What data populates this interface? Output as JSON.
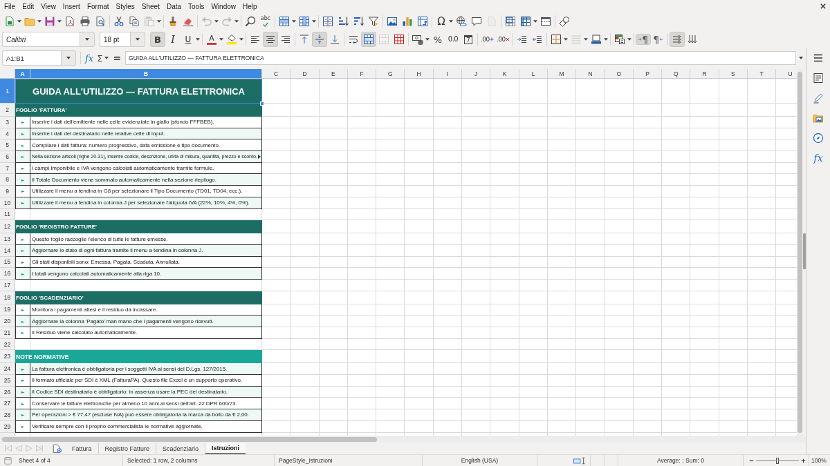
{
  "menu": [
    "File",
    "Edit",
    "View",
    "Insert",
    "Format",
    "Styles",
    "Sheet",
    "Data",
    "Tools",
    "Window",
    "Help"
  ],
  "standard_toolbar": {
    "paste": {
      "disabled": true
    },
    "undo": {
      "disabled": true
    },
    "redo": {
      "disabled": true
    },
    "spelling": {
      "glyph": "abc"
    },
    "special_character": {
      "glyph": "Ω"
    },
    "headers_and_footers": {
      "disabled": true
    }
  },
  "formatting_toolbar": {
    "font_name": "Calibri",
    "font_size": "18 pt",
    "bold": {
      "glyph": "B",
      "selected": true
    },
    "italic": {
      "glyph": "I",
      "selected": false
    },
    "underline": {
      "glyph": "U",
      "selected": false
    },
    "font_color": {
      "glyph": "A"
    },
    "align_left": {
      "selected": false
    },
    "align_center": {
      "selected": true
    },
    "align_right": {
      "selected": false
    },
    "align_top": {
      "selected": false
    },
    "center_vertically": {
      "selected": true
    },
    "align_bottom": {
      "selected": false
    },
    "wrap_text": {
      "selected": false
    },
    "merge_and_center": {
      "selected": true
    },
    "merge_cells": {
      "disabled": true
    },
    "percent": {
      "glyph": "%"
    },
    "number_format": {
      "glyph": "0.0"
    },
    "date_format": {
      "glyph": "7"
    },
    "add_decimal": {
      "glyph": ".00"
    },
    "delete_decimal": {
      "glyph": ".00"
    },
    "border_style": {
      "disabled": true
    },
    "left_to_right": {
      "glyph": "¶",
      "selected": true
    },
    "right_to_left": {
      "glyph": "¶",
      "selected": false
    },
    "text_left_to_right": {
      "selected": true
    },
    "text_top_to_bottom": {
      "selected": false
    }
  },
  "formula_bar": {
    "name_box": "A1:B1",
    "function_wizard": "fx",
    "sum": "Σ",
    "formula": "=",
    "content": "GUIDA ALL'UTILIZZO — FATTURA ELETTRONICA"
  },
  "columns": [
    {
      "label": "A",
      "selected": true
    },
    {
      "label": "B",
      "selected": true
    },
    {
      "label": "C",
      "selected": false
    },
    {
      "label": "D",
      "selected": false
    },
    {
      "label": "E",
      "selected": false
    },
    {
      "label": "F",
      "selected": false
    },
    {
      "label": "G",
      "selected": false
    },
    {
      "label": "H",
      "selected": false
    },
    {
      "label": "I",
      "selected": false
    },
    {
      "label": "J",
      "selected": false
    },
    {
      "label": "K",
      "selected": false
    },
    {
      "label": "L",
      "selected": false
    },
    {
      "label": "M",
      "selected": false
    },
    {
      "label": "N",
      "selected": false
    },
    {
      "label": "O",
      "selected": false
    },
    {
      "label": "P",
      "selected": false
    },
    {
      "label": "Q",
      "selected": false
    },
    {
      "label": "R",
      "selected": false
    },
    {
      "label": "S",
      "selected": false
    },
    {
      "label": "T",
      "selected": false
    },
    {
      "label": "U",
      "selected": false
    }
  ],
  "rows": [
    {
      "number": "1",
      "selected": true,
      "kind": "title",
      "text": "GUIDA ALL'UTILIZZO — FATTURA ELETTRONICA",
      "color": "#1c6e64"
    },
    {
      "number": "2",
      "selected": false,
      "kind": "section",
      "text": "FOGLIO 'FATTURA'",
      "color": "#1c6e64"
    },
    {
      "number": "3",
      "selected": false,
      "kind": "item",
      "bullet": "►",
      "text": "Inserire i dati dell'emittente nelle celle evidenziate in giallo (sfondo FFFBEB).",
      "shaded": false,
      "clipped": false
    },
    {
      "number": "4",
      "selected": false,
      "kind": "item",
      "bullet": "►",
      "text": "Inserire i dati del destinatario nelle relative celle di input.",
      "shaded": true,
      "clipped": false
    },
    {
      "number": "5",
      "selected": false,
      "kind": "item",
      "bullet": "►",
      "text": "Compilare i dati fattura: numero progressivo, data emissione e tipo documento.",
      "shaded": false,
      "clipped": false
    },
    {
      "number": "6",
      "selected": false,
      "kind": "item",
      "bullet": "►",
      "text": "Nella sezione articoli (righe 20-31), inserire codice, descrizione, unità di misura, quantità, prezzo e sconto.",
      "shaded": true,
      "clipped": true
    },
    {
      "number": "7",
      "selected": false,
      "kind": "item",
      "bullet": "►",
      "text": "I campi Imponibile e IVA vengono calcolati automaticamente tramite formule.",
      "shaded": false,
      "clipped": false
    },
    {
      "number": "8",
      "selected": false,
      "kind": "item",
      "bullet": "►",
      "text": "Il Totale Documento viene sommato automaticamente nella sezione riepilogo.",
      "shaded": true,
      "clipped": false
    },
    {
      "number": "9",
      "selected": false,
      "kind": "item",
      "bullet": "►",
      "text": "Utilizzare il menu a tendina in G8 per selezionare il Tipo Documento (TD01, TD04, ecc.).",
      "shaded": false,
      "clipped": false
    },
    {
      "number": "10",
      "selected": false,
      "kind": "item",
      "bullet": "►",
      "text": "Utilizzare il menu a tendina in colonna J per selezionare l'aliquota IVA (22%, 10%, 4%, 0%).",
      "shaded": true,
      "clipped": false
    },
    {
      "number": "11",
      "selected": false,
      "kind": "blank"
    },
    {
      "number": "12",
      "selected": false,
      "kind": "section",
      "text": "FOGLIO 'REGISTRO FATTURE'",
      "color": "#1c6e64"
    },
    {
      "number": "13",
      "selected": false,
      "kind": "item",
      "bullet": "►",
      "text": "Questo foglio raccoglie l'elenco di tutte le fatture emesse.",
      "shaded": false,
      "clipped": false
    },
    {
      "number": "14",
      "selected": false,
      "kind": "item",
      "bullet": "►",
      "text": "Aggiornare lo stato di ogni fattura tramite il menu a tendina in colonna J.",
      "shaded": true,
      "clipped": false
    },
    {
      "number": "15",
      "selected": false,
      "kind": "item",
      "bullet": "►",
      "text": "Gli stati disponibili sono: Emessa, Pagata, Scaduta, Annullata.",
      "shaded": false,
      "clipped": false
    },
    {
      "number": "16",
      "selected": false,
      "kind": "item",
      "bullet": "►",
      "text": "I totali vengono calcolati automaticamente alla riga 10.",
      "shaded": true,
      "clipped": false
    },
    {
      "number": "17",
      "selected": false,
      "kind": "blank"
    },
    {
      "number": "18",
      "selected": false,
      "kind": "section",
      "text": "FOGLIO 'SCADENZIARIO'",
      "color": "#1c6e64"
    },
    {
      "number": "19",
      "selected": false,
      "kind": "item",
      "bullet": "►",
      "text": "Monitora i pagamenti attesi e il residuo da incassare.",
      "shaded": false,
      "clipped": false
    },
    {
      "number": "20",
      "selected": false,
      "kind": "item",
      "bullet": "►",
      "text": "Aggiornare la colonna 'Pagato' man mano che i pagamenti vengono ricevuti.",
      "shaded": true,
      "clipped": false
    },
    {
      "number": "21",
      "selected": false,
      "kind": "item",
      "bullet": "►",
      "text": "Il Residuo viene calcolato automaticamente.",
      "shaded": false,
      "clipped": false
    },
    {
      "number": "22",
      "selected": false,
      "kind": "blank"
    },
    {
      "number": "23",
      "selected": false,
      "kind": "notes_heading",
      "text": "NOTE NORMATIVE",
      "color": "#1ba797"
    },
    {
      "number": "24",
      "selected": false,
      "kind": "item",
      "bullet": "►",
      "text": "La fattura elettronica è obbligatoria per i soggetti IVA ai sensi del D.Lgs. 127/2015.",
      "shaded": true,
      "clipped": false
    },
    {
      "number": "25",
      "selected": false,
      "kind": "item",
      "bullet": "►",
      "text": "Il formato ufficiale per SDI è XML (FatturaPA). Questo file Excel è un supporto operativo.",
      "shaded": false,
      "clipped": false
    },
    {
      "number": "26",
      "selected": false,
      "kind": "item",
      "bullet": "►",
      "text": "Il Codice SDI destinatario è obbligatorio: in assenza usare la PEC del destinatario.",
      "shaded": true,
      "clipped": false
    },
    {
      "number": "27",
      "selected": false,
      "kind": "item",
      "bullet": "►",
      "text": "Conservare le fatture elettroniche per almeno 10 anni ai sensi dell'art. 22 DPR 600/73.",
      "shaded": false,
      "clipped": false
    },
    {
      "number": "28",
      "selected": false,
      "kind": "item",
      "bullet": "►",
      "text": "Per operazioni > € 77,47 (escluse IVA) può essere obbligatoria la marca da bollo da € 2,00.",
      "shaded": true,
      "clipped": false
    },
    {
      "number": "29",
      "selected": false,
      "kind": "item",
      "bullet": "►",
      "text": "Verificare sempre con il proprio commercialista le normative aggiornate.",
      "shaded": false,
      "clipped": false
    }
  ],
  "sheet_tab_bar": {
    "navigation": {
      "disabled": true
    },
    "tabs": [
      {
        "label": "Fattura",
        "selected": false
      },
      {
        "label": "Registro Fatture",
        "selected": false
      },
      {
        "label": "Scadenziario",
        "selected": false
      },
      {
        "label": "Istruzioni",
        "selected": true
      }
    ]
  },
  "sidebar": {
    "functions": "fx"
  },
  "status_bar": {
    "sheet": "Sheet 4 of 4",
    "selection": "Selected: 1 row, 2 columns",
    "page_style": "PageStyle_Istruzioni",
    "language": "English (USA)",
    "summary": "Average: ; Sum: 0",
    "zoom_slider": {
      "level": 0.5
    },
    "zoom": "100%"
  }
}
